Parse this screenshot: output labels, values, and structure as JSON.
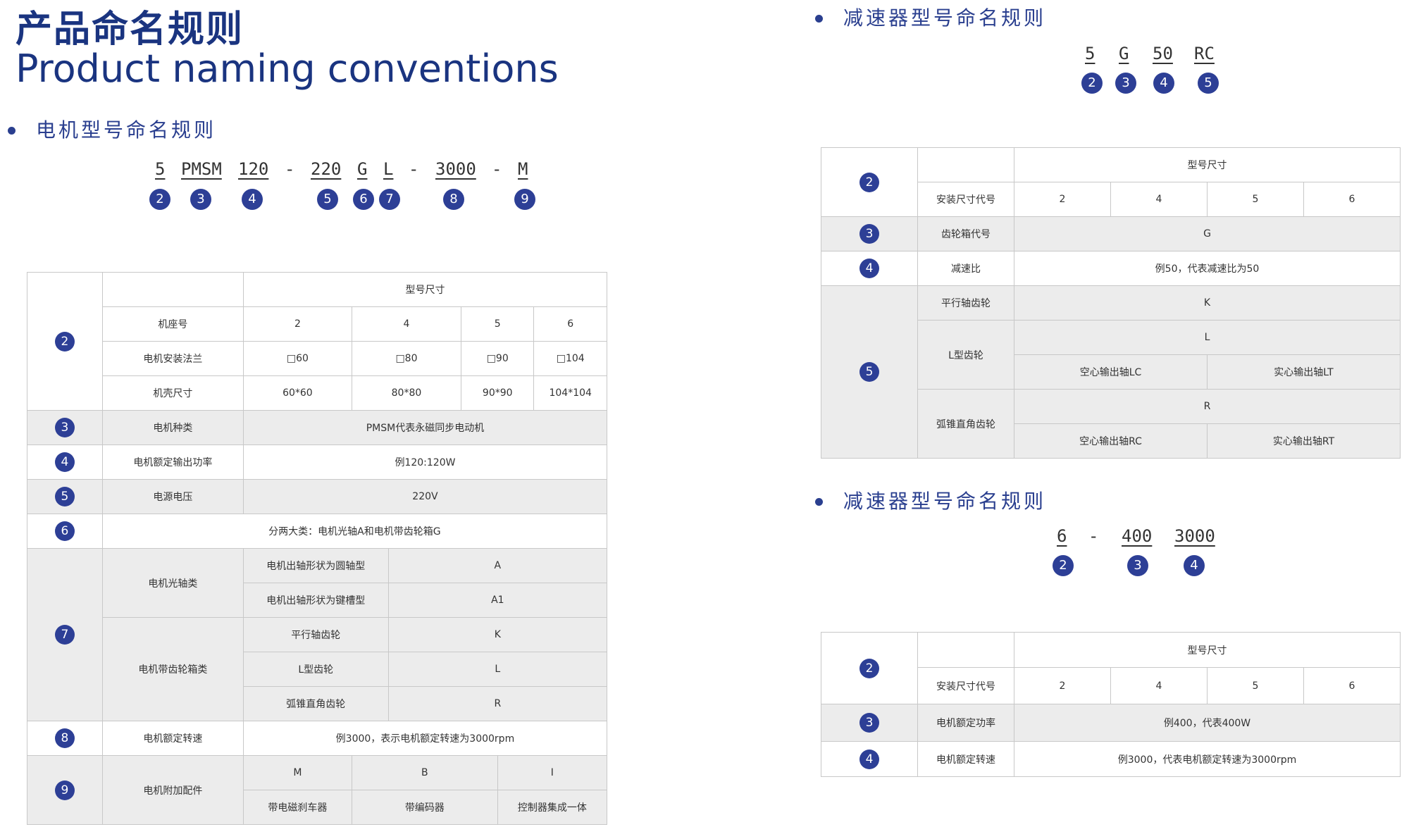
{
  "header": {
    "title_cn": "产品命名规则",
    "title_en": "Product naming conventions"
  },
  "motor": {
    "heading": "电机型号命名规则",
    "codes": [
      "5",
      "PMSM",
      "120",
      "-",
      "220",
      "G",
      "L",
      "-",
      "3000",
      "-",
      "M"
    ],
    "markers": [
      "2",
      "3",
      "4",
      "5",
      "6",
      "7",
      "8",
      "9"
    ],
    "table": {
      "size_header": "型号尺寸",
      "frame_label": "机座号",
      "frame_values": [
        "2",
        "4",
        "5",
        "6"
      ],
      "flange_label": "电机安装法兰",
      "flange_values": [
        "□60",
        "□80",
        "□90",
        "□104"
      ],
      "housing_label": "机壳尺寸",
      "housing_values": [
        "60*60",
        "80*80",
        "90*90",
        "104*104"
      ],
      "type_label": "电机种类",
      "type_value": "PMSM代表永磁同步电动机",
      "power_label": "电机额定输出功率",
      "power_value": "例120:120W",
      "voltage_label": "电源电压",
      "voltage_value": "220V",
      "category_value": "分两大类：电机光轴A和电机带齿轮箱G",
      "shaft_label": "电机光轴类",
      "shaft_round": "电机出轴形状为圆轴型",
      "shaft_round_code": "A",
      "shaft_key": "电机出轴形状为键槽型",
      "shaft_key_code": "A1",
      "gearbox_label": "电机带齿轮箱类",
      "parallel": "平行轴齿轮",
      "parallel_code": "K",
      "lgear": "L型齿轮",
      "lgear_code": "L",
      "bevel": "弧锥直角齿轮",
      "bevel_code": "R",
      "speed_label": "电机额定转速",
      "speed_value": "例3000，表示电机额定转速为3000rpm",
      "acc_label": "电机附加配件",
      "acc_codes": [
        "M",
        "B",
        "I"
      ],
      "acc_values": [
        "带电磁刹车器",
        "带编码器",
        "控制器集成一体"
      ]
    }
  },
  "reducer1": {
    "heading": "减速器型号命名规则",
    "codes": [
      "5",
      "G",
      "50",
      "RC"
    ],
    "markers": [
      "2",
      "3",
      "4",
      "5"
    ],
    "table": {
      "size_header": "型号尺寸",
      "mount_label": "安装尺寸代号",
      "mount_values": [
        "2",
        "4",
        "5",
        "6"
      ],
      "gearbox_label": "齿轮箱代号",
      "gearbox_value": "G",
      "ratio_label": "减速比",
      "ratio_value": "例50，代表减速比为50",
      "parallel": "平行轴齿轮",
      "parallel_code": "K",
      "lgear": "L型齿轮",
      "lgear_code": "L",
      "lgear_hollow": "空心输出轴LC",
      "lgear_solid": "实心输出轴LT",
      "bevel": "弧锥直角齿轮",
      "bevel_code": "R",
      "bevel_hollow": "空心输出轴RC",
      "bevel_solid": "实心输出轴RT"
    }
  },
  "reducer2": {
    "heading": "减速器型号命名规则",
    "codes": [
      "6",
      "-",
      "400",
      "3000"
    ],
    "markers": [
      "2",
      "3",
      "4"
    ],
    "table": {
      "size_header": "型号尺寸",
      "mount_label": "安装尺寸代号",
      "mount_values": [
        "2",
        "4",
        "5",
        "6"
      ],
      "power_label": "电机额定功率",
      "power_value": "例400，代表400W",
      "speed_label": "电机额定转速",
      "speed_value": "例3000，代表电机额定转速为3000rpm"
    }
  },
  "colors": {
    "brand_blue": "#1a3480",
    "marker_blue": "#2d3f96",
    "row_gray": "#ececec"
  }
}
